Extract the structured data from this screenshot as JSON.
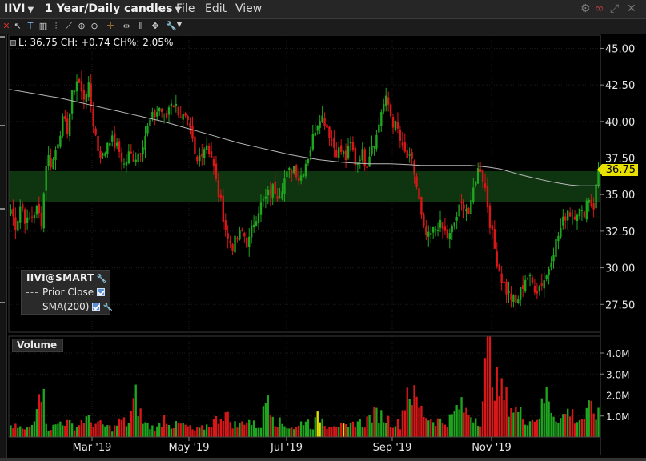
{
  "titlebar": {
    "symbol": "IIVI",
    "period": "1 Year/Daily candles",
    "menu_file": "File",
    "menu_edit": "Edit",
    "menu_view": "View"
  },
  "info": {
    "text": "L: 36.75 CH: +0.74 CH%: 2.05%"
  },
  "legend": {
    "title": "IIVI@SMART",
    "prior_close": "Prior Close",
    "sma": "SMA(200)"
  },
  "volume_panel": {
    "label": "Volume"
  },
  "last_price_flag": "36.75",
  "colors": {
    "up": "#1fa51f",
    "down": "#d81818",
    "neutral": "#e0e000",
    "sma": "#b8b8b8",
    "band": "#0f3a12"
  },
  "chart_data": {
    "type": "candlestick",
    "x_labels": [
      "Mar '19",
      "May '19",
      "Jul '19",
      "Sep '19",
      "Nov '19"
    ],
    "price_ticks": [
      "45.00",
      "42.50",
      "40.00",
      "37.50",
      "35.00",
      "32.50",
      "30.00",
      "27.50"
    ],
    "price_ylim": [
      25.6,
      45.9
    ],
    "volume_ticks": [
      "4.0M",
      "3.0M",
      "2.0M",
      "1.0M"
    ],
    "volume_ylim": [
      0,
      4.8
    ],
    "highlight_band": [
      34.5,
      36.6
    ],
    "close_path": [
      34.0,
      32.8,
      34.5,
      33.0,
      33.5,
      34.0,
      33.2,
      37.8,
      37.0,
      38.5,
      40.0,
      39.5,
      42.0,
      43.0,
      41.5,
      42.5,
      40.0,
      38.0,
      37.5,
      39.0,
      38.5,
      38.0,
      37.0,
      37.8,
      37.5,
      38.0,
      39.0,
      40.0,
      40.5,
      41.0,
      40.0,
      41.5,
      41.0,
      40.5,
      40.0,
      39.0,
      37.0,
      38.0,
      38.5,
      37.5,
      35.5,
      34.0,
      32.0,
      31.5,
      32.0,
      32.5,
      31.5,
      33.0,
      34.0,
      34.5,
      35.0,
      35.5,
      35.0,
      36.0,
      36.5,
      37.0,
      36.0,
      37.0,
      38.0,
      39.5,
      40.5,
      40.0,
      39.0,
      38.0,
      38.0,
      37.5,
      38.5,
      37.0,
      38.0,
      37.0,
      38.5,
      39.0,
      41.0,
      41.5,
      40.0,
      39.5,
      38.0,
      37.5,
      37.0,
      35.0,
      32.5,
      32.0,
      32.5,
      33.0,
      32.5,
      32.0,
      33.0,
      34.0,
      34.5,
      33.5,
      36.0,
      37.0,
      35.5,
      33.0,
      31.0,
      29.5,
      28.5,
      28.0,
      27.5,
      28.5,
      29.5,
      29.0,
      28.5,
      29.0,
      29.5,
      31.0,
      32.0,
      33.0,
      34.0,
      33.5,
      34.0,
      33.5,
      35.0,
      34.0,
      36.75
    ],
    "sma_path": [
      42.2,
      41.9,
      41.6,
      41.2,
      40.8,
      40.4,
      40.0,
      39.5,
      39.0,
      38.5,
      38.1,
      37.7,
      37.4,
      37.2,
      37.1,
      37.1,
      37.0,
      37.0,
      37.0,
      36.8,
      36.3,
      35.9,
      35.6,
      35.6
    ],
    "volume_path": [
      0.4,
      0.5,
      0.3,
      0.6,
      3.1,
      0.4,
      0.5,
      0.8,
      0.6,
      0.5,
      0.9,
      0.7,
      0.6,
      0.5,
      0.4,
      0.8,
      0.6,
      1.9,
      0.7,
      0.5,
      0.4,
      1.0,
      0.5,
      0.6,
      0.5,
      0.3,
      0.4,
      0.6,
      0.8,
      1.2,
      0.7,
      0.5,
      0.9,
      0.6,
      0.5,
      2.2,
      0.8,
      0.6,
      0.5,
      0.4,
      0.9,
      0.5,
      1.0,
      0.6,
      0.7,
      0.5,
      0.4,
      0.8,
      0.6,
      1.0,
      1.1,
      0.9,
      0.7,
      0.6,
      2.4,
      1.8,
      1.2,
      0.9,
      0.8,
      0.7,
      0.9,
      1.5,
      1.2,
      1.0,
      0.8,
      4.7,
      2.5,
      2.0,
      1.5,
      1.2,
      0.9,
      0.8,
      1.1,
      2.1,
      1.0,
      0.9,
      1.3,
      0.8,
      0.9,
      1.4,
      1.0
    ]
  }
}
